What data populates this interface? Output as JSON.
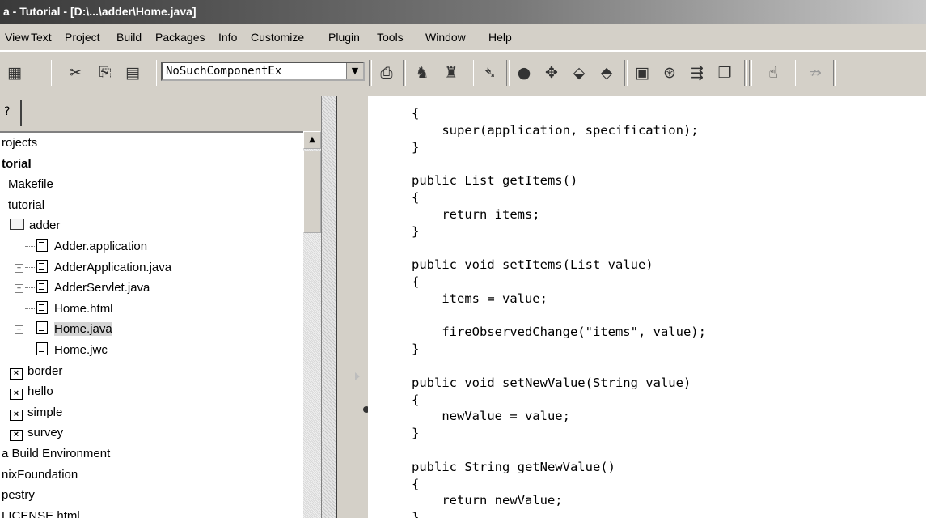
{
  "window": {
    "title": "a - Tutorial - [D:\\...\\adder\\Home.java]"
  },
  "menu": [
    "View",
    "Text",
    "Project",
    "Build",
    "Packages",
    "Info",
    "Customize",
    "Plugin",
    "Tools",
    "Window",
    "Help"
  ],
  "toolbar": {
    "combo_value": "NoSuchComponentEx",
    "icons": [
      "disk-stack-icon",
      "scissors-icon",
      "copy-icon",
      "paste-icon",
      "print-icon",
      "find-icon",
      "find-next-icon",
      "goto-icon",
      "breakpoint-icon",
      "step-over-icon",
      "step-into-icon",
      "step-out-icon",
      "terminal-icon",
      "stop-icon",
      "compile-icon",
      "window-icon",
      "hand-icon",
      "disabled-icon"
    ]
  },
  "left_pane": {
    "tab_label": "?"
  },
  "tree": [
    {
      "label": "rojects",
      "indent": 0
    },
    {
      "label": "torial",
      "indent": 0,
      "bold": true
    },
    {
      "label": "Makefile",
      "indent": 1
    },
    {
      "label": "tutorial",
      "indent": 1
    },
    {
      "label": "adder",
      "indent": 2,
      "icon": "folder"
    },
    {
      "label": "Adder.application",
      "indent": 3,
      "icon": "file"
    },
    {
      "label": "AdderApplication.java",
      "indent": 3,
      "icon": "file",
      "expander": true
    },
    {
      "label": "AdderServlet.java",
      "indent": 3,
      "icon": "file",
      "expander": true
    },
    {
      "label": "Home.html",
      "indent": 3,
      "icon": "file"
    },
    {
      "label": "Home.java",
      "indent": 3,
      "icon": "file",
      "expander": true,
      "selected": true
    },
    {
      "label": "Home.jwc",
      "indent": 3,
      "icon": "file"
    },
    {
      "label": "border",
      "indent": 2,
      "icon": "closed"
    },
    {
      "label": "hello",
      "indent": 2,
      "icon": "closed"
    },
    {
      "label": "simple",
      "indent": 2,
      "icon": "closed"
    },
    {
      "label": "survey",
      "indent": 2,
      "icon": "closed"
    },
    {
      "label": "a Build Environment",
      "indent": 0
    },
    {
      "label": "nixFoundation",
      "indent": 0
    },
    {
      "label": "pestry",
      "indent": 0
    },
    {
      "label": "LICENSE.html",
      "indent": 0
    }
  ],
  "code": [
    "{",
    "    super(application, specification);",
    "}",
    "",
    "public List getItems()",
    "{",
    "    return items;",
    "}",
    "",
    "public void setItems(List value)",
    "{",
    "    items = value;",
    "",
    "    fireObservedChange(\"items\", value);",
    "}",
    "",
    "public void setNewValue(String value)",
    "{",
    "    newValue = value;",
    "}",
    "",
    "public String getNewValue()",
    "{",
    "    return newValue;",
    "}"
  ]
}
